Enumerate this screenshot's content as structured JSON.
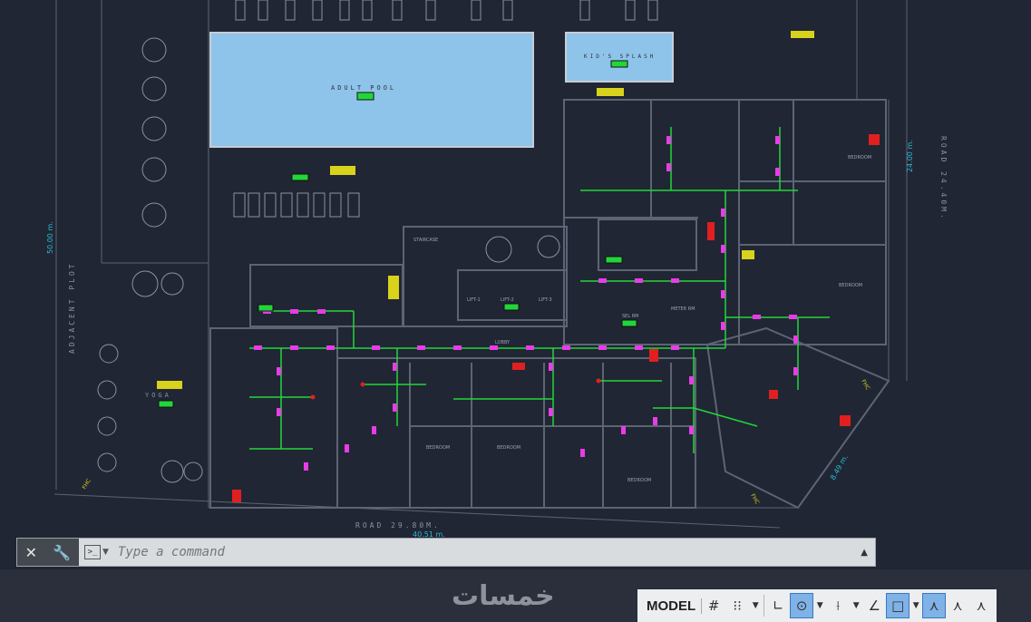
{
  "drawing": {
    "labels": {
      "adult_pool": "ADULT POOL",
      "kids_splash": "KID'S SPLASH",
      "road_right": "ROAD 24.40M.",
      "road_bottom": "ROAD 29.80M.",
      "adjacent_plot": "ADJACENT PLOT",
      "yoga": "YOGA",
      "staircase": "STAIRCASE",
      "bedroom": "BEDROOM",
      "lift_1": "LIFT-1",
      "lift_2": "LIFT-2",
      "lift_3": "LIFT-3",
      "sel_rm": "SEL RM",
      "meter_rm": "METER RM",
      "lobby": "LOBBY"
    },
    "dimensions": {
      "width_top": "24.00 m.",
      "height_left": "50.00 m.",
      "bottom": "40.51 m.",
      "diagonal": "8.49 m."
    },
    "colors": {
      "background": "#202633",
      "pipe_green": "#22d63a",
      "sprinkler_magenta": "#e83ce8",
      "pool_blue": "#8fc4ea",
      "wall_grey": "#5c6475",
      "symbol_red": "#e02020",
      "symbol_yellow": "#d8d21c"
    }
  },
  "command_line": {
    "close_icon": "close-icon",
    "settings_icon": "wrench-icon",
    "placeholder": "Type a command"
  },
  "watermark": "خمسات",
  "status_bar": {
    "model_label": "MODEL",
    "icons": [
      "grid-icon",
      "snap-icon",
      "ortho-icon",
      "polar-icon",
      "isodraft-icon",
      "osnap-track-icon",
      "object-snap-icon",
      "annotation-visibility-icon",
      "autoscale-icon"
    ]
  }
}
